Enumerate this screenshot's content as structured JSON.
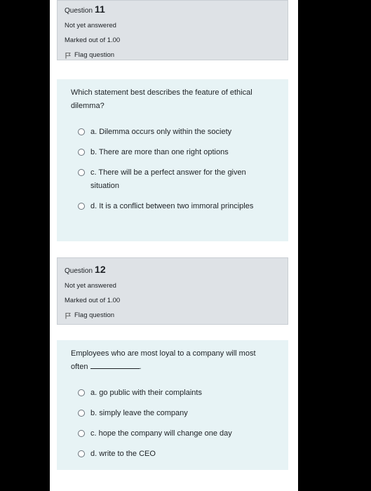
{
  "q11": {
    "label": "Question",
    "number": "11",
    "status": "Not yet answered",
    "marks": "Marked out of 1.00",
    "flag": "Flag question",
    "text": "Which statement best describes the feature of ethical dilemma?",
    "options": [
      "a. Dilemma occurs only within the society",
      "b. There are more than one right options",
      "c. There will be a perfect answer for the given situation",
      "d. It is a conflict between two immoral principles"
    ]
  },
  "q12": {
    "label": "Question",
    "number": "12",
    "status": "Not yet answered",
    "marks": "Marked out of 1.00",
    "flag": "Flag question",
    "text_before": "Employees who are most loyal to a company will most often",
    "text_after": ".",
    "options": [
      "a. go public with their complaints",
      "b. simply leave the company",
      "c. hope the company will change one day",
      "d. write to the CEO"
    ]
  }
}
